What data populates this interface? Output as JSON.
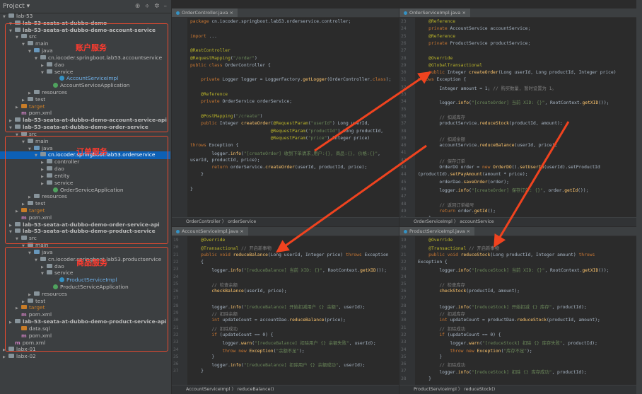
{
  "project_header": {
    "title": "Project"
  },
  "tree": [
    {
      "id": "lab53",
      "label": "lab-53",
      "d": 0,
      "icon": "fold",
      "y": 0
    },
    {
      "id": "root",
      "label": "lab-53-seata-at-dubbo-demo",
      "d": 1,
      "icon": "fold",
      "y": 1,
      "bold": true
    },
    {
      "id": "acc",
      "label": "lab-53-seata-at-dubbo-demo-account-service",
      "d": 1,
      "icon": "fold",
      "y": 2,
      "bold": true
    },
    {
      "id": "src1",
      "label": "src",
      "d": 2,
      "icon": "fold",
      "y": 3
    },
    {
      "id": "main1",
      "label": "main",
      "d": 3,
      "icon": "fold",
      "y": 4
    },
    {
      "id": "java1",
      "label": "java",
      "d": 4,
      "icon": "fold",
      "blue": true,
      "y": 5
    },
    {
      "id": "pkg1",
      "label": "cn.iocoder.springboot.lab53.accountservice",
      "d": 5,
      "icon": "fold",
      "y": 6
    },
    {
      "id": "dao1",
      "label": "dao",
      "d": 6,
      "icon": "fold",
      "y": 7
    },
    {
      "id": "svc1",
      "label": "service",
      "d": 6,
      "icon": "fold",
      "y": 8
    },
    {
      "id": "impl1",
      "label": "AccountServiceImpl",
      "d": 8,
      "icon": "cls",
      "y": 9,
      "color": "#6fb1e9"
    },
    {
      "id": "app1",
      "label": "AccountServiceApplication",
      "d": 7,
      "icon": "cls",
      "y": 10
    },
    {
      "id": "res1",
      "label": "resources",
      "d": 4,
      "icon": "fold",
      "y": 11
    },
    {
      "id": "test1",
      "label": "test",
      "d": 3,
      "icon": "fold",
      "y": 12
    },
    {
      "id": "tgt1",
      "label": "target",
      "d": 2,
      "icon": "fold",
      "orange": true,
      "y": 13,
      "color": "#c97d28"
    },
    {
      "id": "pom1",
      "label": "pom.xml",
      "d": 2,
      "icon": "m",
      "y": 14
    },
    {
      "id": "accapi",
      "label": "lab-53-seata-at-dubbo-demo-account-service-api",
      "d": 1,
      "icon": "fold",
      "y": 15,
      "bold": true
    },
    {
      "id": "ord",
      "label": "lab-53-seata-at-dubbo-demo-order-service",
      "d": 1,
      "icon": "fold",
      "y": 16,
      "bold": true
    },
    {
      "id": "src2",
      "label": "src",
      "d": 2,
      "icon": "fold",
      "y": 17
    },
    {
      "id": "main2",
      "label": "main",
      "d": 3,
      "icon": "fold",
      "y": 18
    },
    {
      "id": "java2",
      "label": "java",
      "d": 4,
      "icon": "fold",
      "blue": true,
      "y": 19
    },
    {
      "id": "pkg2",
      "label": "cn.iocoder.springboot.lab53.orderservice",
      "d": 5,
      "icon": "fold",
      "y": 20,
      "selected": true
    },
    {
      "id": "ctl2",
      "label": "controller",
      "d": 6,
      "icon": "fold",
      "y": 21
    },
    {
      "id": "dao2",
      "label": "dao",
      "d": 6,
      "icon": "fold",
      "y": 22
    },
    {
      "id": "ent2",
      "label": "entity",
      "d": 6,
      "icon": "fold",
      "y": 23
    },
    {
      "id": "svc2",
      "label": "service",
      "d": 6,
      "icon": "fold",
      "y": 24
    },
    {
      "id": "app2",
      "label": "OrderServiceApplication",
      "d": 7,
      "icon": "cls",
      "y": 25
    },
    {
      "id": "res2",
      "label": "resources",
      "d": 4,
      "icon": "fold",
      "y": 26
    },
    {
      "id": "test2",
      "label": "test",
      "d": 3,
      "icon": "fold",
      "y": 27
    },
    {
      "id": "tgt2",
      "label": "target",
      "d": 2,
      "icon": "fold",
      "orange": true,
      "y": 28,
      "color": "#c97d28"
    },
    {
      "id": "pom2",
      "label": "pom.xml",
      "d": 2,
      "icon": "m",
      "y": 29
    },
    {
      "id": "ordapi",
      "label": "lab-53-seata-at-dubbo-demo-order-service-api",
      "d": 1,
      "icon": "fold",
      "y": 30,
      "bold": true
    },
    {
      "id": "prod",
      "label": "lab-53-seata-at-dubbo-demo-product-service",
      "d": 1,
      "icon": "fold",
      "y": 31,
      "bold": true
    },
    {
      "id": "src3",
      "label": "src",
      "d": 2,
      "icon": "fold",
      "y": 32
    },
    {
      "id": "main3",
      "label": "main",
      "d": 3,
      "icon": "fold",
      "y": 33
    },
    {
      "id": "java3",
      "label": "java",
      "d": 4,
      "icon": "fold",
      "blue": true,
      "y": 34
    },
    {
      "id": "pkg3",
      "label": "cn.iocoder.springboot.lab53.productservice",
      "d": 5,
      "icon": "fold",
      "y": 35
    },
    {
      "id": "dao3",
      "label": "dao",
      "d": 6,
      "icon": "fold",
      "y": 36
    },
    {
      "id": "svc3",
      "label": "service",
      "d": 6,
      "icon": "fold",
      "y": 37
    },
    {
      "id": "impl3",
      "label": "ProductServiceImpl",
      "d": 8,
      "icon": "cls",
      "y": 38,
      "color": "#6fb1e9"
    },
    {
      "id": "app3",
      "label": "ProductServiceApplication",
      "d": 7,
      "icon": "cls",
      "y": 39
    },
    {
      "id": "res3",
      "label": "resources",
      "d": 4,
      "icon": "fold",
      "y": 40
    },
    {
      "id": "test3",
      "label": "test",
      "d": 3,
      "icon": "fold",
      "y": 41
    },
    {
      "id": "tgt3",
      "label": "target",
      "d": 2,
      "icon": "fold",
      "orange": true,
      "y": 42,
      "color": "#c97d28"
    },
    {
      "id": "pom3",
      "label": "pom.xml",
      "d": 2,
      "icon": "m",
      "y": 43
    },
    {
      "id": "prodapi",
      "label": "lab-53-seata-at-dubbo-demo-product-service-api",
      "d": 1,
      "icon": "fold",
      "y": 44,
      "bold": true
    },
    {
      "id": "datasql",
      "label": "data.sql",
      "d": 2,
      "icon": "sql",
      "y": 45
    },
    {
      "id": "pomroot",
      "label": "pom.xml",
      "d": 2,
      "icon": "m",
      "y": 46
    },
    {
      "id": "pomlab",
      "label": "pom.xml",
      "d": 1,
      "icon": "m",
      "y": 47
    },
    {
      "id": "labx01",
      "label": "labx-01",
      "d": 0,
      "icon": "fold",
      "y": 48
    },
    {
      "id": "labx02",
      "label": "labx-02",
      "d": 0,
      "icon": "fold",
      "y": 49
    }
  ],
  "labels": {
    "account": "账户服务",
    "order": "订单服务",
    "product": "商品服务"
  },
  "right_tools": [
    "Database",
    "Bean Validation",
    "Maven",
    "Notifications"
  ],
  "panes": {
    "order_controller": {
      "tab": "OrderController.java",
      "crumb": "OrderController  〉 orderService",
      "line_numbers": [],
      "lines": [
        "package cn.iocoder.springboot.lab53.orderservice.controller;",
        "",
        "import ...",
        "",
        "@RestController",
        "@RequestMapping(\"/order\")",
        "public class OrderController {",
        "",
        "    private Logger logger = LoggerFactory.getLogger(OrderController.class);",
        "",
        "    @Reference",
        "    private OrderService orderService;",
        "",
        "    @PostMapping(\"/create\")",
        "    public Integer createOrder(@RequestParam(\"userId\") Long userId,",
        "                              @RequestParam(\"productId\") Long productId,",
        "                              @RequestParam(\"price\") Integer price)",
        "throws Exception {",
        "        logger.info(\"[createOrder] 收到下单请求,用户:{}, 商品:{}, 价格:{}\",",
        "userId, productId, price);",
        "        return orderService.createOrder(userId, productId, price);",
        "    }",
        "",
        "}"
      ]
    },
    "order_service_impl": {
      "tab": "OrderServiceImpl.java",
      "crumb": "OrderServiceImpl  〉 accountService",
      "line_numbers": [
        "23",
        "24",
        "25",
        "26",
        "27",
        "28",
        "29",
        "30",
        "31",
        "32",
        "33",
        "34",
        "35",
        "36",
        "37",
        "38",
        "39",
        "40",
        "41",
        "42",
        "43",
        "44",
        "45",
        "46",
        "47",
        "48",
        "49",
        "50"
      ],
      "lines": [
        "    @Reference",
        "    private AccountService accountService;",
        "    @Reference",
        "    private ProductService productService;",
        "",
        "    @Override",
        "    @GlobalTransactional",
        "    public Integer createOrder(Long userId, Long productId, Integer price)",
        "throws Exception {",
        "        Integer amount = 1; // 购买数量, 暂时设置为 1。",
        "",
        "        logger.info(\"[createOrder] 当前 XID: {}\", RootContext.getXID());",
        "",
        "        // 扣减库存",
        "        productService.reduceStock(productId, amount);",
        "",
        "        // 扣减余额",
        "        accountService.reduceBalance(userId, price);",
        "",
        "        // 保存订单",
        "        OrderDO order = new OrderDO().setUserId(userId).setProductId",
        "(productId).setPayAmount(amount * price);",
        "        orderDao.saveOrder(order);",
        "        logger.info(\"[createOrder] 保存订单: {}\", order.getId());",
        "",
        "        // 返回订单编号",
        "        return order.getId();",
        "    }"
      ]
    },
    "account_service_impl": {
      "tab": "AccountServiceImpl.java",
      "crumb": "AccountServiceImpl  〉 reduceBalance()",
      "line_numbers": [
        "19",
        "20",
        "21",
        "22",
        "23",
        "24",
        "25",
        "26",
        "27",
        "28",
        "29",
        "30",
        "31",
        "32",
        "33",
        "34",
        "35",
        "36",
        "37",
        "38",
        "39",
        "40",
        "41",
        "42"
      ],
      "lines": [
        "    @Override",
        "    @Transactional // 开启新事物",
        "    public void reduceBalance(Long userId, Integer price) throws Exception",
        "    {",
        "        logger.info(\"[reduceBalance] 当前 XID: {}\", RootContext.getXID());",
        "",
        "        // 检查余额",
        "        checkBalance(userId, price);",
        "",
        "        logger.info(\"[reduceBalance] 开始扣减用户 {} 余额\", userId);",
        "        // 扣除余额",
        "        int updateCount = accountDao.reduceBalance(price);",
        "        // 扣除成功",
        "        if (updateCount == 0) {",
        "            logger.warn(\"[reduceBalance] 扣除用户 {} 余额失败\", userId);",
        "            throw new Exception(\"余额不足\");",
        "        }",
        "        logger.info(\"[reduceBalance] 扣除用户 {} 余额成功\", userId);",
        "    }"
      ]
    },
    "product_service_impl": {
      "tab": "ProductServiceImpl.java",
      "crumb": "ProductServiceImpl  〉 reduceStock()",
      "line_numbers": [
        "19",
        "20",
        "21",
        "22",
        "23",
        "24",
        "25",
        "26",
        "27",
        "28",
        "29",
        "30",
        "31",
        "32",
        "33",
        "34",
        "35",
        "36",
        "37",
        "38",
        "39",
        "40",
        "41",
        "42"
      ],
      "lines": [
        "    @Override",
        "    @Transactional // 开启新事物",
        "    public void reduceStock(Long productId, Integer amount) throws",
        "Exception {",
        "        logger.info(\"[reduceStock] 当前 XID: {}\", RootContext.getXID());",
        "",
        "        // 检查库存",
        "        checkStock(productId, amount);",
        "",
        "        logger.info(\"[reduceStock] 开始扣减 {} 库存\", productId);",
        "        // 扣减库存",
        "        int updateCount = productDao.reduceStock(productId, amount);",
        "        // 扣除成功",
        "        if (updateCount == 0) {",
        "            logger.warn(\"[reduceStock] 扣除 {} 库存失败\", productId);",
        "            throw new Exception(\"库存不足\");",
        "        }",
        "        // 扣除成功",
        "        logger.info(\"[reduceStock] 扣除 {} 库存成功\", productId);",
        "    }"
      ]
    }
  }
}
